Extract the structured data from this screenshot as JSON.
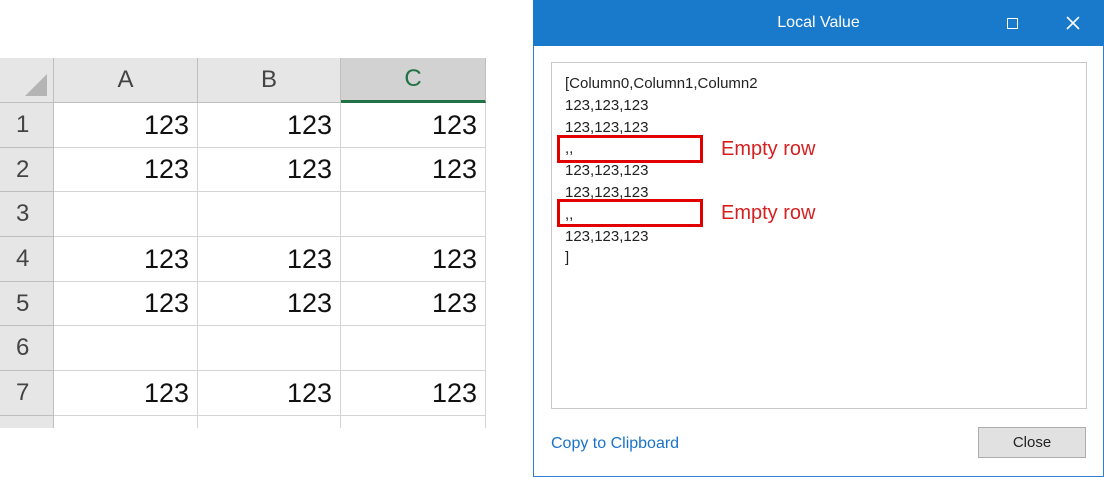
{
  "spreadsheet": {
    "columns": [
      "A",
      "B",
      "C"
    ],
    "active_column": "C",
    "rows": [
      {
        "label": "1",
        "cells": [
          "123",
          "123",
          "123"
        ]
      },
      {
        "label": "2",
        "cells": [
          "123",
          "123",
          "123"
        ]
      },
      {
        "label": "3",
        "cells": [
          "",
          "",
          ""
        ]
      },
      {
        "label": "4",
        "cells": [
          "123",
          "123",
          "123"
        ]
      },
      {
        "label": "5",
        "cells": [
          "123",
          "123",
          "123"
        ]
      },
      {
        "label": "6",
        "cells": [
          "",
          "",
          ""
        ]
      },
      {
        "label": "7",
        "cells": [
          "123",
          "123",
          "123"
        ]
      }
    ]
  },
  "dialog": {
    "title": "Local Value",
    "content_lines": [
      "[Column0,Column1,Column2",
      "123,123,123",
      "123,123,123",
      ",,",
      "123,123,123",
      "123,123,123",
      ",,",
      "123,123,123",
      "]"
    ],
    "copy_label": "Copy to Clipboard",
    "close_label": "Close"
  },
  "annotations": [
    "Empty row",
    "Empty row"
  ],
  "colors": {
    "titlebar": "#1979ca",
    "link": "#1a73c9",
    "annotation": "#d61f1f",
    "active_column": "#217346"
  }
}
